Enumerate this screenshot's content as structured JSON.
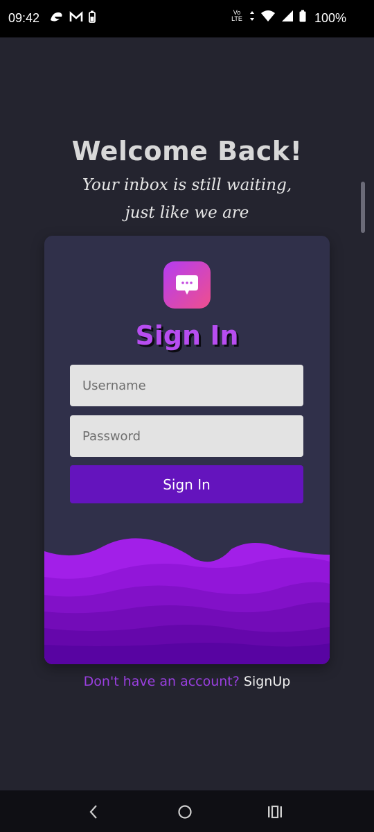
{
  "status_bar": {
    "time": "09:42",
    "network_label": "Vo LTE",
    "battery": "100%",
    "icons": [
      "edge-icon",
      "gmail-icon",
      "battery-saver-icon",
      "volte-icon",
      "data-arrows-icon",
      "wifi-icon",
      "signal-icon",
      "battery-icon"
    ]
  },
  "header": {
    "title": "Welcome Back!",
    "tagline_line1": "Your inbox is still waiting,",
    "tagline_line2": "just like we are"
  },
  "card": {
    "app_icon": "chat-bubble-icon",
    "title": "Sign In",
    "username_placeholder": "Username",
    "password_placeholder": "Password",
    "button_label": "Sign In"
  },
  "footer": {
    "question": "Don't have an account?",
    "link": "SignUp"
  },
  "nav": {
    "icons": [
      "back-icon",
      "home-icon",
      "recents-icon"
    ]
  },
  "colors": {
    "background": "#24242f",
    "card": "#30304a",
    "accent": "#b74df0",
    "button": "#6414bd"
  }
}
